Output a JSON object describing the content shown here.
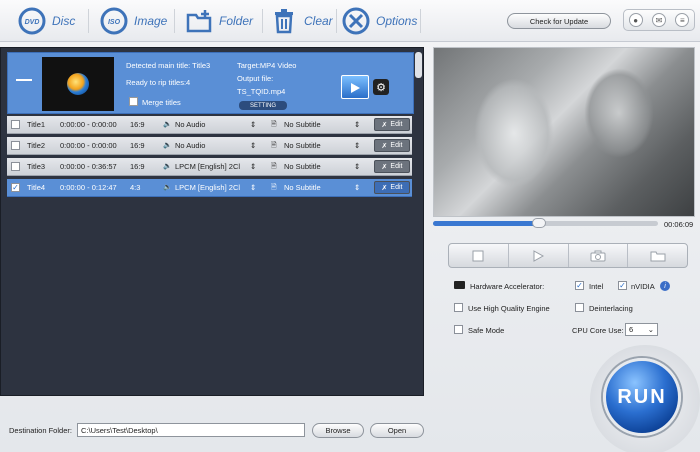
{
  "toolbar": {
    "disc_label": "Disc",
    "image_label": "Image",
    "folder_label": "Folder",
    "clear_label": "Clear",
    "options_label": "Options",
    "check_update_label": "Check for Update"
  },
  "summary": {
    "detected": "Detected main title: Title3",
    "ready": "Ready to rip titles:4",
    "merge": "Merge titles",
    "target": "Target:MP4 Video",
    "output_label": "Output file:",
    "output_file": "TS_TQID.mp4",
    "setting": "SETTING"
  },
  "titles": [
    {
      "name": "Title1",
      "time": "0:00:00 - 0:00:00",
      "aspect": "16:9",
      "audio": "No Audio",
      "subtitle": "No Subtitle",
      "checked": false,
      "selected": false
    },
    {
      "name": "Title2",
      "time": "0:00:00 - 0:00:00",
      "aspect": "16:9",
      "audio": "No Audio",
      "subtitle": "No Subtitle",
      "checked": false,
      "selected": false
    },
    {
      "name": "Title3",
      "time": "0:00:00 - 0:36:57",
      "aspect": "16:9",
      "audio": "LPCM  [English]  2Cl",
      "subtitle": "No Subtitle",
      "checked": false,
      "selected": false
    },
    {
      "name": "Title4",
      "time": "0:00:00 - 0:12:47",
      "aspect": "4:3",
      "audio": "LPCM  [English]  2Cl",
      "subtitle": "No Subtitle",
      "checked": true,
      "selected": true
    }
  ],
  "edit_label": "Edit",
  "destination": {
    "label": "Destination Folder:",
    "value": "C:\\Users\\Test\\Desktop\\",
    "browse": "Browse",
    "open": "Open"
  },
  "player": {
    "time": "00:06:09",
    "progress": 0.47
  },
  "settings": {
    "hw_label": "Hardware Accelerator:",
    "intel": "Intel",
    "nvidia": "nVIDIA",
    "hq": "Use High Quality Engine",
    "deinterlacing": "Deinterlacing",
    "safe": "Safe Mode",
    "cpu_label": "CPU Core Use:",
    "cpu_value": "6"
  },
  "run_label": "RUN"
}
